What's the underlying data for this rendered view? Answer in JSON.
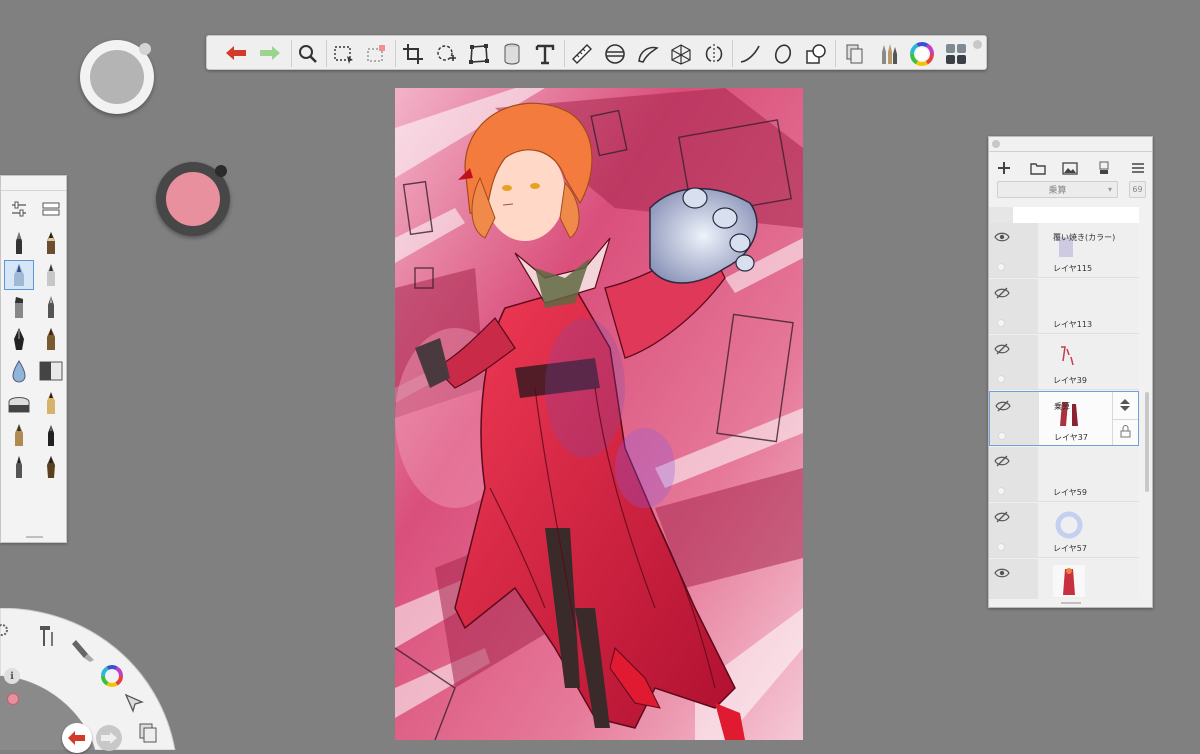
{
  "toolbar": {
    "tools": [
      "undo",
      "redo",
      "zoom",
      "select-rect",
      "select-lasso",
      "crop",
      "transform",
      "distort",
      "perspective",
      "text",
      "ruler",
      "ellipse-guide",
      "french-curve",
      "perspective-grid",
      "symmetry",
      "stroke",
      "ellipse-shape",
      "shapes",
      "copic-library",
      "brush-library",
      "color-wheel",
      "layout"
    ]
  },
  "colors": {
    "puck_primary": "#b4b4b4",
    "puck_secondary": "#e8909d",
    "accent": "#5f97d6"
  },
  "brush_palette": {
    "top_icons": [
      "brush-properties-icon",
      "brush-set-icon"
    ],
    "selected": "pen-blue"
  },
  "layer_editor": {
    "blend_mode": "乗算",
    "opacity": "69",
    "layers": [
      {
        "mode": "覆い焼き(カラー)",
        "name": "レイヤ115",
        "visible": true
      },
      {
        "mode": "",
        "name": "レイヤ113",
        "visible": false
      },
      {
        "mode": "",
        "name": "レイヤ39",
        "visible": false
      },
      {
        "mode": "乗算",
        "name": "レイヤ37",
        "visible": false,
        "selected": true
      },
      {
        "mode": "",
        "name": "レイヤ59",
        "visible": false
      },
      {
        "mode": "",
        "name": "レイヤ57",
        "visible": false
      },
      {
        "mode": "",
        "name": "",
        "visible": true
      }
    ]
  }
}
